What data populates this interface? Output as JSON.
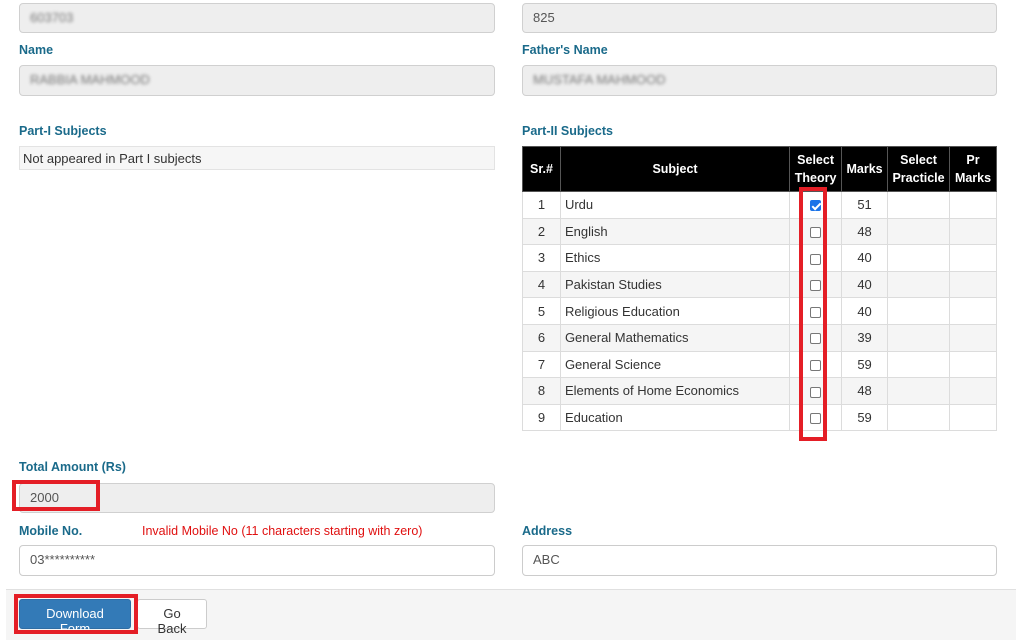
{
  "top_fields": {
    "left_value": "603703",
    "right_value": "825"
  },
  "name_section": {
    "name_label": "Name",
    "name_value": "RABBIA MAHMOOD",
    "father_label": "Father's Name",
    "father_value": "MUSTAFA MAHMOOD"
  },
  "part1": {
    "label": "Part-I Subjects",
    "message": "Not appeared in Part I subjects"
  },
  "part2": {
    "label": "Part-II Subjects",
    "headers": {
      "sr": "Sr.#",
      "subject": "Subject",
      "select_theory_1": "Select",
      "select_theory_2": "Theory",
      "marks": "Marks",
      "select_practicle_1": "Select",
      "select_practicle_2": "Practicle",
      "pr_marks_1": "Pr",
      "pr_marks_2": "Marks"
    },
    "rows": [
      {
        "sr": "1",
        "subject": "Urdu",
        "checked": true,
        "marks": "51"
      },
      {
        "sr": "2",
        "subject": "English",
        "checked": false,
        "marks": "48"
      },
      {
        "sr": "3",
        "subject": "Ethics",
        "checked": false,
        "marks": "40"
      },
      {
        "sr": "4",
        "subject": "Pakistan Studies",
        "checked": false,
        "marks": "40"
      },
      {
        "sr": "5",
        "subject": "Religious Education",
        "checked": false,
        "marks": "40"
      },
      {
        "sr": "6",
        "subject": "General Mathematics",
        "checked": false,
        "marks": "39"
      },
      {
        "sr": "7",
        "subject": "General Science",
        "checked": false,
        "marks": "59"
      },
      {
        "sr": "8",
        "subject": "Elements of Home Economics",
        "checked": false,
        "marks": "48"
      },
      {
        "sr": "9",
        "subject": "Education",
        "checked": false,
        "marks": "59"
      }
    ]
  },
  "total_amount": {
    "label": "Total Amount (Rs)",
    "value": "2000"
  },
  "mobile": {
    "label": "Mobile No.",
    "error": "Invalid Mobile No (11 characters starting with zero)",
    "value": "03**********"
  },
  "address": {
    "label": "Address",
    "value": "ABC"
  },
  "footer": {
    "download_label": "Download Form",
    "back_label": "Go Back"
  },
  "colors": {
    "label": "#1a6a8a",
    "error": "#e01010",
    "highlight": "#e41e26",
    "primary_button": "#337ab7",
    "table_header": "#000000"
  }
}
